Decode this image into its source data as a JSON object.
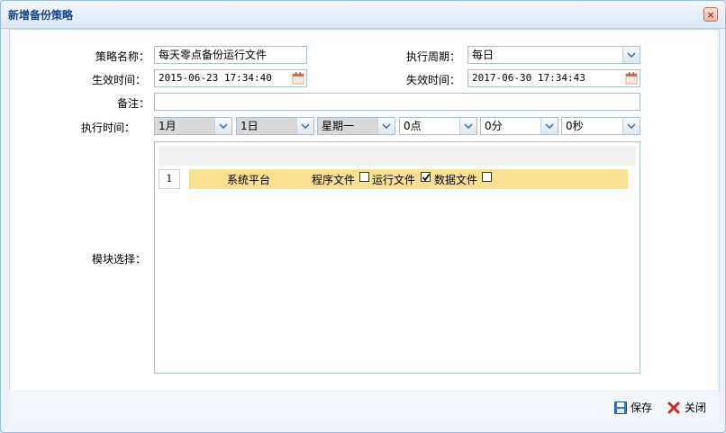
{
  "dialog": {
    "title": "新增备份策略",
    "close_symbol": "×"
  },
  "form": {
    "name_label": "策略名称：",
    "name_value": "每天零点备份运行文件",
    "cycle_label": "执行周期：",
    "cycle_value": "每日",
    "effective_label": "生效时间：",
    "effective_value": "2015-06-23 17:34:40",
    "expire_label": "失效时间：",
    "expire_value": "2017-06-30 17:34:43",
    "remark_label": "备注：",
    "remark_value": "",
    "exec_label": "执行时间：",
    "exec_month": "1月",
    "exec_day": "1日",
    "exec_weekday": "星期一",
    "exec_hour": "0点",
    "exec_minute": "0分",
    "exec_second": "0秒",
    "module_label": "模块选择："
  },
  "modules": {
    "row_number": "1",
    "platform": "系统平台",
    "program_files": "程序文件",
    "program_files_checked": false,
    "run_files": "运行文件",
    "run_files_checked": true,
    "data_files": "数据文件",
    "data_files_checked": false
  },
  "footer": {
    "save_label": "保存",
    "close_label": "关闭"
  },
  "colors": {
    "title": "#15428b",
    "row_highlight": "#fbe091",
    "border": "#a9bfd6"
  }
}
